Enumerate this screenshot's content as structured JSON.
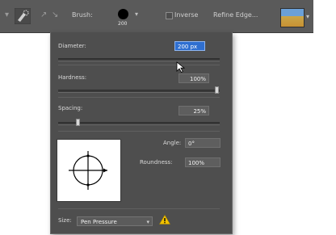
{
  "toolbar": {
    "brush_label": "Brush:",
    "brush_size": "200",
    "inverse_label": "Inverse",
    "refine_edge_label": "Refine Edge..."
  },
  "panel": {
    "diameter": {
      "label": "Diameter:",
      "value": "200 px"
    },
    "hardness": {
      "label": "Hardness:",
      "value": "100%",
      "slider_fraction": 1.0
    },
    "spacing": {
      "label": "Spacing:",
      "value": "25%",
      "slider_fraction": 0.25
    },
    "angle": {
      "label": "Angle:",
      "value": "0°"
    },
    "roundness": {
      "label": "Roundness:",
      "value": "100%"
    },
    "size": {
      "label": "Size:",
      "value": "Pen Pressure"
    }
  },
  "icons": {
    "tool": "quick-selection-icon",
    "warning": "warning-icon"
  }
}
